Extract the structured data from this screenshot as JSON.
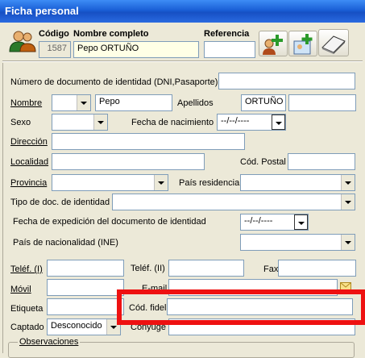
{
  "window": {
    "title": "Ficha personal"
  },
  "header": {
    "codigo_label": "Código",
    "nombre_completo_label": "Nombre completo",
    "referencia_label": "Referencia",
    "codigo_value": "1587",
    "nombre_completo_value": "Pepo ORTUÑO",
    "referencia_value": ""
  },
  "form": {
    "documento_label": "Número de documento de identidad (DNI,Pasaporte)",
    "nombre_label": "Nombre",
    "nombre_value": "Pepo",
    "apellidos_label": "Apellidos",
    "apellidos_value": "ORTUÑO",
    "sexo_label": "Sexo",
    "fecha_nac_label": "Fecha de nacimiento",
    "fecha_nac_value": "--/--/----",
    "direccion_label": "Dirección",
    "localidad_label": "Localidad",
    "cod_postal_label": "Cód. Postal",
    "provincia_label": "Provincia",
    "pais_residencia_label": "País residencia",
    "tipo_doc_label": "Tipo de doc. de identidad",
    "fecha_exp_label": "Fecha de expedición del documento de identidad",
    "fecha_exp_value": "--/--/----",
    "pais_nac_label": "País de nacionalidad (INE)",
    "telef1_label": "Teléf. (I)",
    "telef2_label": "Teléf. (II)",
    "fax_label": "Fax",
    "movil_label": "Móvil",
    "email_label": "E-mail",
    "etiqueta_label": "Etiqueta",
    "cod_fidel_label": "Cód. fidel.",
    "captado_label": "Captado",
    "captado_value": "Desconocido",
    "conyuge_label": "Cónyuge",
    "observaciones_label": "Observaciones"
  },
  "colors": {
    "highlight": "#e11111",
    "titlebar": "#1a5fd6"
  }
}
